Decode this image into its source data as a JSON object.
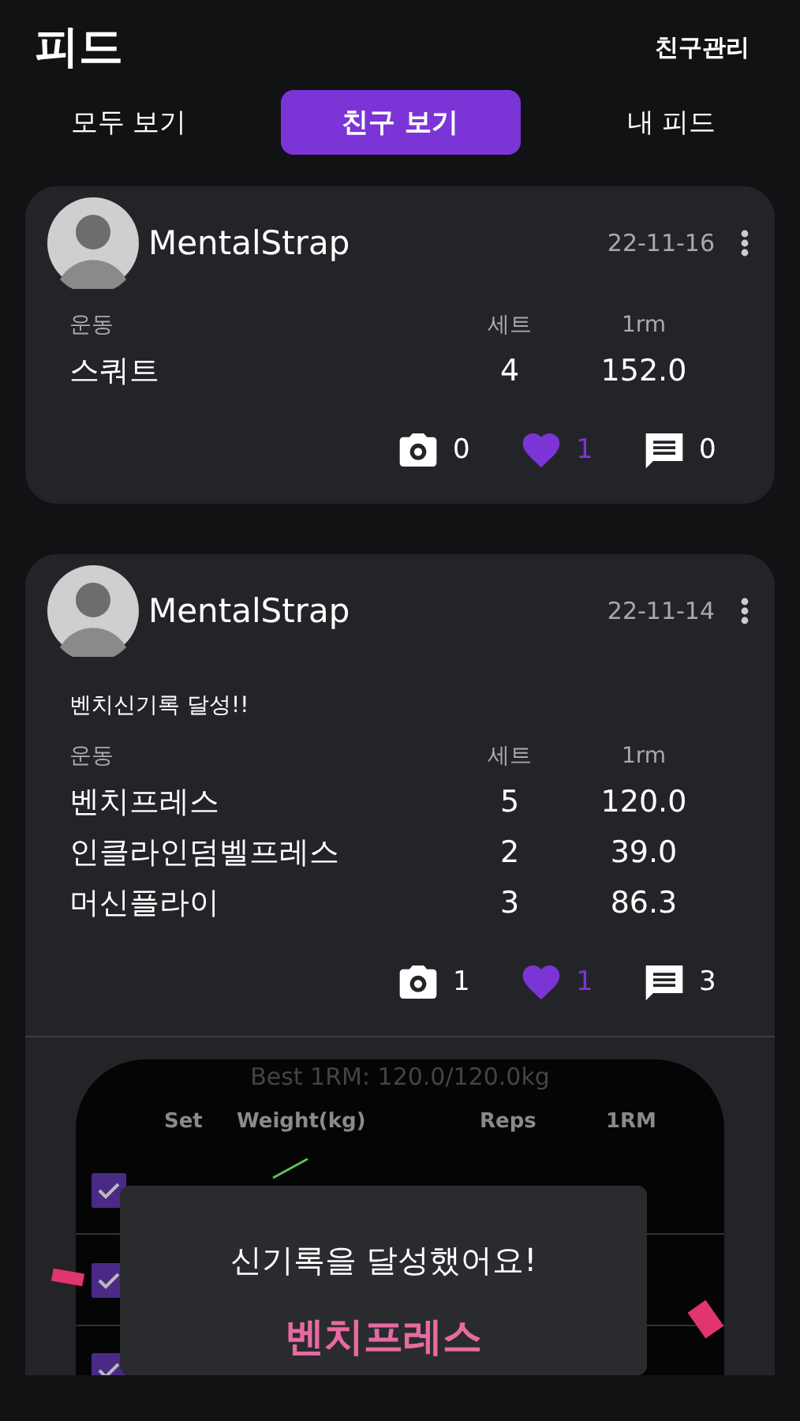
{
  "header": {
    "title": "피드",
    "action": "친구관리"
  },
  "tabs": [
    {
      "label": "모두 보기",
      "selected": false
    },
    {
      "label": "친구 보기",
      "selected": true
    },
    {
      "label": "내 피드",
      "selected": false
    }
  ],
  "posts": [
    {
      "user": "MentalStrap",
      "date": "22-11-16",
      "columns": [
        "운동",
        "세트",
        "1rm"
      ],
      "rows": [
        [
          "스쿼트",
          "4",
          "152.0"
        ]
      ],
      "photos": "0",
      "likes": "1",
      "liked": true,
      "comments": "0"
    },
    {
      "user": "MentalStrap",
      "date": "22-11-14",
      "memo": "벤치신기록 달성!!",
      "columns": [
        "운동",
        "세트",
        "1rm"
      ],
      "rows": [
        [
          "벤치프레스",
          "5",
          "120.0"
        ],
        [
          "인클라인덤벨프레스",
          "2",
          "39.0"
        ],
        [
          "머신플라이",
          "3",
          "86.3"
        ]
      ],
      "photos": "1",
      "likes": "1",
      "liked": true,
      "comments": "3",
      "attachment": {
        "best": "Best 1RM: 120.0/120.0kg",
        "columns": [
          "Set",
          "Weight(kg)",
          "Reps",
          "1RM"
        ],
        "sets": [
          {
            "checked": true
          },
          {
            "checked": true
          },
          {
            "checked": true
          }
        ],
        "dialog": {
          "title": "신기록을 달성했어요!",
          "exercise": "벤치프레스"
        }
      }
    }
  ]
}
